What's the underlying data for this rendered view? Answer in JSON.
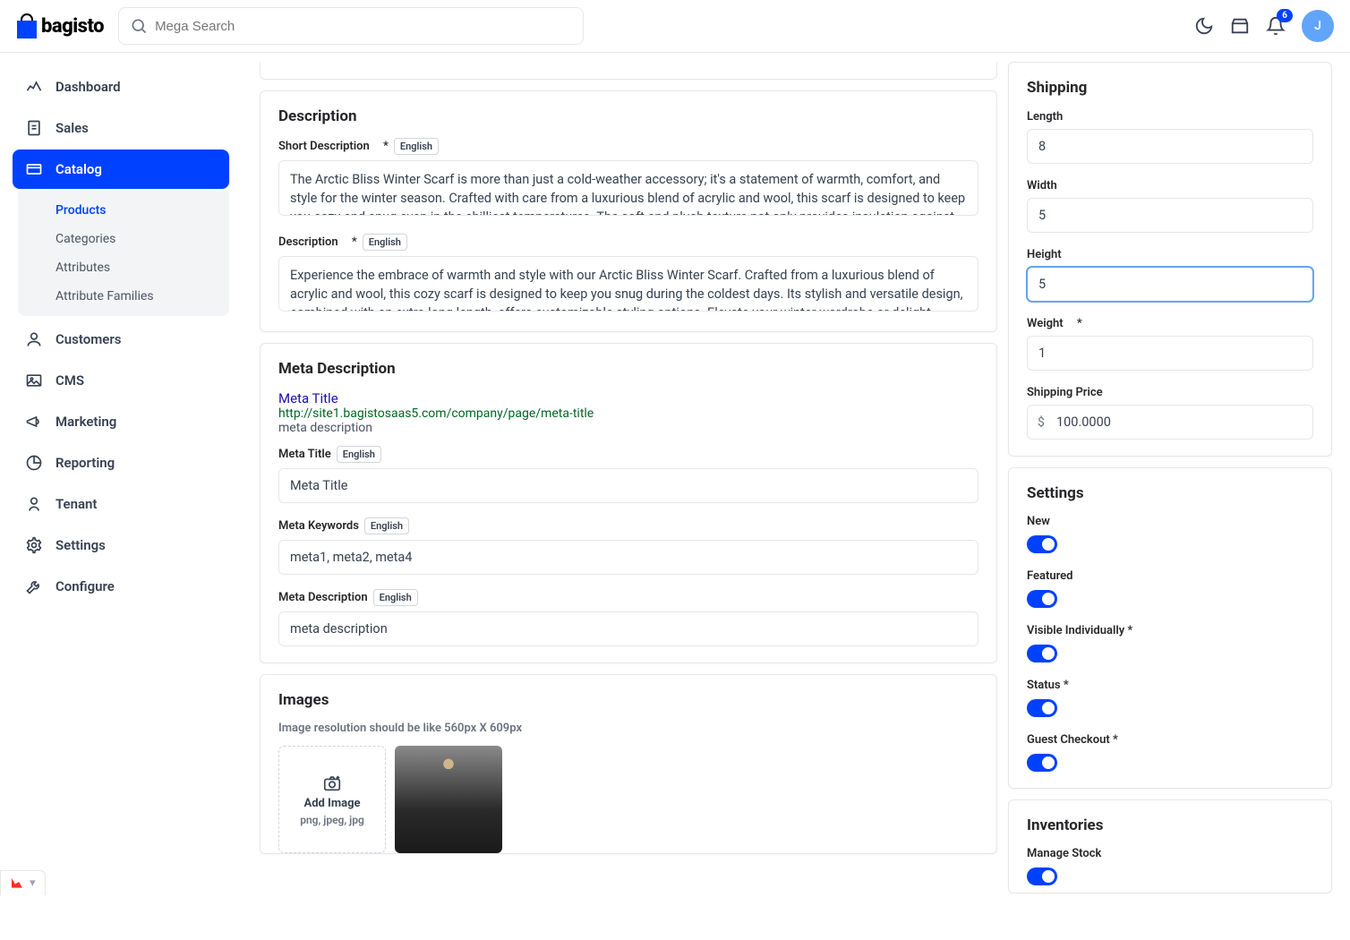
{
  "header": {
    "search_placeholder": "Mega Search",
    "badge": "6",
    "avatar": "J"
  },
  "sidebar": {
    "items": [
      {
        "label": "Dashboard"
      },
      {
        "label": "Sales"
      },
      {
        "label": "Catalog"
      },
      {
        "label": "Customers"
      },
      {
        "label": "CMS"
      },
      {
        "label": "Marketing"
      },
      {
        "label": "Reporting"
      },
      {
        "label": "Tenant"
      },
      {
        "label": "Settings"
      },
      {
        "label": "Configure"
      }
    ],
    "catalog_sub": [
      {
        "label": "Products"
      },
      {
        "label": "Categories"
      },
      {
        "label": "Attributes"
      },
      {
        "label": "Attribute Families"
      }
    ]
  },
  "locale_tag": "English",
  "description": {
    "title": "Description",
    "short_label": "Short Description",
    "short_value": "The Arctic Bliss Winter Scarf is more than just a cold-weather accessory; it's a statement of warmth, comfort, and style for the winter season. Crafted with care from a luxurious blend of acrylic and wool, this scarf is designed to keep you cozy and snug even in the chilliest temperatures. The soft and plush texture not only provides insulation against the cold but also",
    "desc_label": "Description",
    "desc_value": "Experience the embrace of warmth and style with our Arctic Bliss Winter Scarf. Crafted from a luxurious blend of acrylic and wool, this cozy scarf is designed to keep you snug during the coldest days. Its stylish and versatile design, combined with an extra-long length, offers customizable styling options. Elevate your winter wardrobe or delight someone special"
  },
  "meta": {
    "title": "Meta Description",
    "preview_title": "Meta Title",
    "preview_url": "http://site1.bagistosaas5.com/company/page/meta-title",
    "preview_desc": "meta description",
    "mt_label": "Meta Title",
    "mt_value": "Meta Title",
    "mk_label": "Meta Keywords",
    "mk_value": "meta1, meta2, meta4",
    "md_label": "Meta Description",
    "md_value": "meta description"
  },
  "images": {
    "title": "Images",
    "hint": "Image resolution should be like 560px X 609px",
    "add_label": "Add Image",
    "formats": "png, jpeg, jpg"
  },
  "shipping": {
    "title": "Shipping",
    "length_label": "Length",
    "length_value": "8",
    "width_label": "Width",
    "width_value": "5",
    "height_label": "Height",
    "height_value": "5",
    "weight_label": "Weight",
    "weight_value": "1",
    "price_label": "Shipping Price",
    "price_symbol": "$",
    "price_value": "100.0000"
  },
  "settings": {
    "title": "Settings",
    "new_label": "New",
    "featured_label": "Featured",
    "visible_label": "Visible Individually",
    "status_label": "Status",
    "guest_label": "Guest Checkout"
  },
  "inventories": {
    "title": "Inventories",
    "manage_label": "Manage Stock"
  }
}
